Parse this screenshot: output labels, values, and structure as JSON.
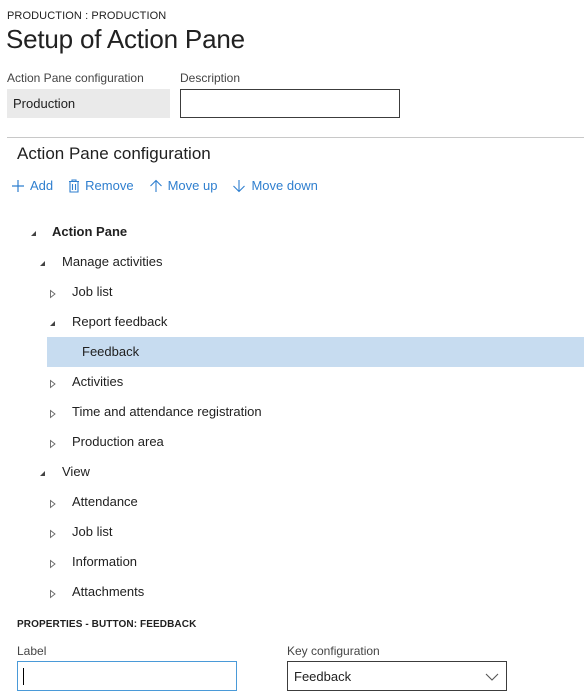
{
  "header": {
    "breadcrumb": "PRODUCTION : PRODUCTION",
    "title": "Setup of Action Pane"
  },
  "form": {
    "config_label": "Action Pane configuration",
    "config_value": "Production",
    "description_label": "Description",
    "description_value": ""
  },
  "section": {
    "title": "Action Pane configuration"
  },
  "toolbar": {
    "add_label": "Add",
    "remove_label": "Remove",
    "move_up_label": "Move up",
    "move_down_label": "Move down"
  },
  "tree": [
    {
      "label": "Action Pane",
      "level": 0,
      "state": "expanded",
      "bold": true,
      "selected": false
    },
    {
      "label": "Manage activities",
      "level": 1,
      "state": "expanded",
      "bold": false,
      "selected": false
    },
    {
      "label": "Job list",
      "level": 2,
      "state": "collapsed",
      "bold": false,
      "selected": false
    },
    {
      "label": "Report feedback",
      "level": 2,
      "state": "expanded",
      "bold": false,
      "selected": false
    },
    {
      "label": "Feedback",
      "level": 3,
      "state": "leaf",
      "bold": false,
      "selected": true
    },
    {
      "label": "Activities",
      "level": 2,
      "state": "collapsed",
      "bold": false,
      "selected": false
    },
    {
      "label": "Time and attendance registration",
      "level": 2,
      "state": "collapsed",
      "bold": false,
      "selected": false
    },
    {
      "label": "Production area",
      "level": 2,
      "state": "collapsed",
      "bold": false,
      "selected": false
    },
    {
      "label": "View",
      "level": 1,
      "state": "expanded",
      "bold": false,
      "selected": false
    },
    {
      "label": "Attendance",
      "level": 2,
      "state": "collapsed",
      "bold": false,
      "selected": false
    },
    {
      "label": "Job list",
      "level": 2,
      "state": "collapsed",
      "bold": false,
      "selected": false
    },
    {
      "label": "Information",
      "level": 2,
      "state": "collapsed",
      "bold": false,
      "selected": false
    },
    {
      "label": "Attachments",
      "level": 2,
      "state": "collapsed",
      "bold": false,
      "selected": false
    }
  ],
  "properties": {
    "title": "PROPERTIES - BUTTON: FEEDBACK",
    "label_field_label": "Label",
    "label_value": "",
    "key_config_label": "Key configuration",
    "key_config_value": "Feedback"
  },
  "colors": {
    "accent": "#2f7fcf",
    "selection": "#c7dcf0",
    "focus_border": "#4a9ad8"
  }
}
